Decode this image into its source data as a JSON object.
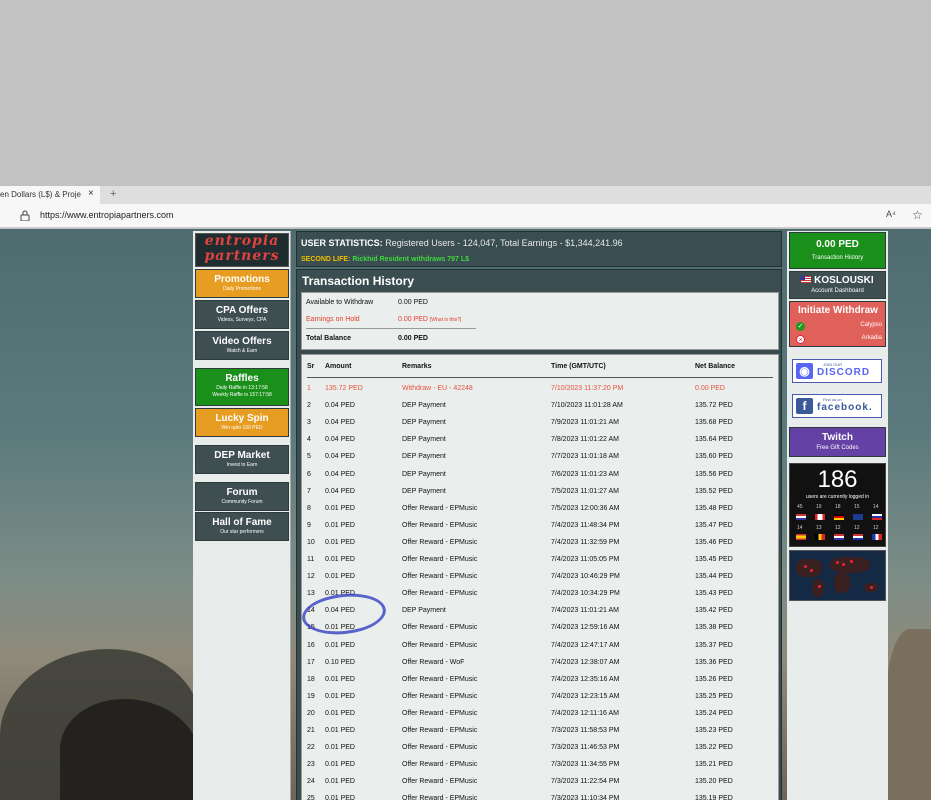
{
  "browser": {
    "tab_title": "en Dollars (L$) & Proje",
    "tab_close": "×",
    "tab_plus": "+",
    "url": "https://www.entropiapartners.com",
    "read_aloud": "A⁴",
    "favorite_icon": "☆"
  },
  "logo": {
    "line1": "entropia",
    "line2": "partners"
  },
  "sidebar": {
    "items": [
      {
        "label": "Promotions",
        "sub": "Daily Promotions",
        "color": "orange"
      },
      {
        "label": "CPA Offers",
        "sub": "Videos, Surveys, CPA",
        "color": "dark"
      },
      {
        "label": "Video Offers",
        "sub": "Watch & Earn",
        "color": "dark"
      },
      {
        "label": "Raffles",
        "sub": "Daily Raffle in 13:17:58",
        "sub2": "Weekly Raffle in 157:17:58",
        "color": "green"
      },
      {
        "label": "Lucky Spin",
        "sub": "Win upto 100 PED",
        "color": "orange"
      },
      {
        "label": "DEP Market",
        "sub": "Invest to Earn",
        "color": "dark"
      },
      {
        "label": "Forum",
        "sub": "Community Forum",
        "color": "dark"
      },
      {
        "label": "Hall of Fame",
        "sub": "Our star performers",
        "color": "dark"
      }
    ]
  },
  "header": {
    "stats_label": "USER STATISTICS:",
    "stats_text": "Registered Users - 124,047, Total Earnings - $1,344,241.96",
    "sl_label": "SECOND LIFE:",
    "sl_text": "Rickhid Resident withdraws 797 L$"
  },
  "main": {
    "title": "Transaction History",
    "balance": {
      "available_label": "Available to Withdraw",
      "available_value": "0.00 PED",
      "hold_label": "Earnings on Hold",
      "hold_value": "0.00 PED",
      "hold_link": "[What is this?]",
      "total_label": "Total Balance",
      "total_value": "0.00 PED"
    },
    "columns": [
      "Sr",
      "Amount",
      "Remarks",
      "Time (GMT/UTC)",
      "Net Balance"
    ],
    "rows": [
      [
        "1",
        "135.72 PED",
        "Withdraw - EU - 42248",
        "7/10/2023 11:37:20 PM",
        "0.00 PED"
      ],
      [
        "2",
        "0.04 PED",
        "DEP Payment",
        "7/10/2023 11:01:28 AM",
        "135.72 PED"
      ],
      [
        "3",
        "0.04 PED",
        "DEP Payment",
        "7/9/2023 11:01:21 AM",
        "135.68 PED"
      ],
      [
        "4",
        "0.04 PED",
        "DEP Payment",
        "7/8/2023 11:01:22 AM",
        "135.64 PED"
      ],
      [
        "5",
        "0.04 PED",
        "DEP Payment",
        "7/7/2023 11:01:18 AM",
        "135.60 PED"
      ],
      [
        "6",
        "0.04 PED",
        "DEP Payment",
        "7/6/2023 11:01:23 AM",
        "135.56 PED"
      ],
      [
        "7",
        "0.04 PED",
        "DEP Payment",
        "7/5/2023 11:01:27 AM",
        "135.52 PED"
      ],
      [
        "8",
        "0.01 PED",
        "Offer Reward - EPMusic",
        "7/5/2023 12:00:36 AM",
        "135.48 PED"
      ],
      [
        "9",
        "0.01 PED",
        "Offer Reward - EPMusic",
        "7/4/2023 11:48:34 PM",
        "135.47 PED"
      ],
      [
        "10",
        "0.01 PED",
        "Offer Reward - EPMusic",
        "7/4/2023 11:32:59 PM",
        "135.46 PED"
      ],
      [
        "11",
        "0.01 PED",
        "Offer Reward - EPMusic",
        "7/4/2023 11:05:05 PM",
        "135.45 PED"
      ],
      [
        "12",
        "0.01 PED",
        "Offer Reward - EPMusic",
        "7/4/2023 10:46:29 PM",
        "135.44 PED"
      ],
      [
        "13",
        "0.01 PED",
        "Offer Reward - EPMusic",
        "7/4/2023 10:34:29 PM",
        "135.43 PED"
      ],
      [
        "14",
        "0.04 PED",
        "DEP Payment",
        "7/4/2023 11:01:21 AM",
        "135.42 PED"
      ],
      [
        "15",
        "0.01 PED",
        "Offer Reward - EPMusic",
        "7/4/2023 12:59:16 AM",
        "135.38 PED"
      ],
      [
        "16",
        "0.01 PED",
        "Offer Reward - EPMusic",
        "7/4/2023 12:47:17 AM",
        "135.37 PED"
      ],
      [
        "17",
        "0.10 PED",
        "Offer Reward - WoF",
        "7/4/2023 12:38:07 AM",
        "135.36 PED"
      ],
      [
        "18",
        "0.01 PED",
        "Offer Reward - EPMusic",
        "7/4/2023 12:35:16 AM",
        "135.26 PED"
      ],
      [
        "19",
        "0.01 PED",
        "Offer Reward - EPMusic",
        "7/4/2023 12:23:15 AM",
        "135.25 PED"
      ],
      [
        "20",
        "0.01 PED",
        "Offer Reward - EPMusic",
        "7/4/2023 12:11:16 AM",
        "135.24 PED"
      ],
      [
        "21",
        "0.01 PED",
        "Offer Reward - EPMusic",
        "7/3/2023 11:58:53 PM",
        "135.23 PED"
      ],
      [
        "22",
        "0.01 PED",
        "Offer Reward - EPMusic",
        "7/3/2023 11:46:53 PM",
        "135.22 PED"
      ],
      [
        "23",
        "0.01 PED",
        "Offer Reward - EPMusic",
        "7/3/2023 11:34:55 PM",
        "135.21 PED"
      ],
      [
        "24",
        "0.01 PED",
        "Offer Reward - EPMusic",
        "7/3/2023 11:22:54 PM",
        "135.20 PED"
      ],
      [
        "25",
        "0.01 PED",
        "Offer Reward - EPMusic",
        "7/3/2023 11:10:34 PM",
        "135.19 PED"
      ]
    ]
  },
  "rightbar": {
    "balance_value": "0.00 PED",
    "balance_sub": "Transaction History",
    "user_name": "KOSLOUSKI",
    "user_sub": "Account Dashboard",
    "withdraw_title": "Initiate Withdraw",
    "withdraw_options": [
      "Calypso",
      "Arkadia"
    ],
    "discord_sub": "JOIN OUR",
    "discord_text": "DISCORD",
    "facebook_sub": "Find us on",
    "facebook_text": "facebook.",
    "twitch_title": "Twitch",
    "twitch_sub": "Free Gift Codes",
    "online_count": "186",
    "online_label": "users are currently logged in",
    "flag_counts_row1": [
      "45",
      "19",
      "18",
      "15",
      "14"
    ],
    "flag_counts_row2": [
      "14",
      "13",
      "12",
      "12",
      "12"
    ]
  },
  "colors": {
    "accent_orange": "#e69d21",
    "accent_green": "#1a8f1a",
    "panel_dark": "#3a4d50",
    "withdraw_red": "#e53e2d",
    "twitch_purple": "#6441a5"
  }
}
